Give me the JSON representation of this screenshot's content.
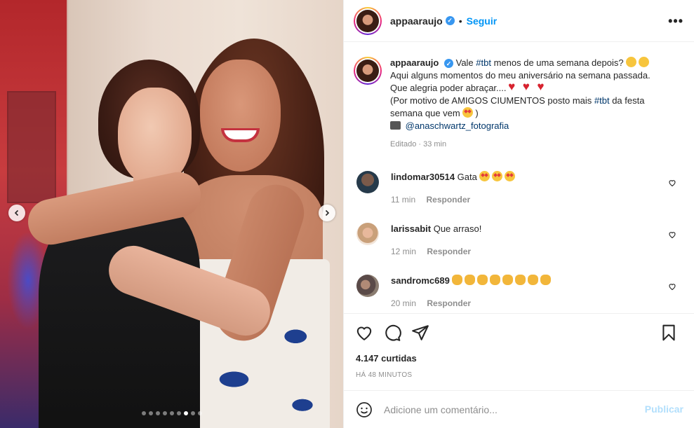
{
  "post": {
    "username": "appaaraujo",
    "verified": true,
    "separator": "•",
    "follow_label": "Seguir",
    "more_label": "•••"
  },
  "caption": {
    "username": "appaaraujo",
    "line1_text": "Vale ",
    "line1_tag": "#tbt",
    "line1_rest": " menos de uma semana depois?",
    "line2": "Aqui alguns momentos do meu aniversário na semana passada.",
    "line3": "Que alegria poder abraçar....",
    "line4_text": "(Por motivo de AMIGOS CIUMENTOS posto mais ",
    "line4_tag": "#tbt",
    "line4_rest": " da festa",
    "line5": "semana que vem",
    "line5_close": ")",
    "credit": "@anaschwartz_fotografia",
    "meta": "Editado · 33 min"
  },
  "comments": [
    {
      "user": "lindomar30514",
      "text": "Gata",
      "emoji": [
        "star-eyes",
        "star-eyes",
        "star-eyes"
      ],
      "time": "11 min",
      "reply": "Responder"
    },
    {
      "user": "larissabit",
      "text": "Que arraso!",
      "emoji": [],
      "time": "12 min",
      "reply": "Responder"
    },
    {
      "user": "sandromc689",
      "text": "",
      "emoji": [
        "clap",
        "clap",
        "clap",
        "clap",
        "clap",
        "clap",
        "clap",
        "clap"
      ],
      "time": "20 min",
      "reply": "Responder"
    }
  ],
  "actions": {
    "likes": "4.147 curtidas",
    "time": "HÁ 48 MINUTOS"
  },
  "add_comment": {
    "placeholder": "Adicione um comentário...",
    "publish": "Publicar"
  },
  "carousel": {
    "slides": 9,
    "active_index": 6
  },
  "colors": {
    "accent": "#0095f6",
    "publish_disabled": "#b2dffc",
    "verified": "#3897f0"
  }
}
